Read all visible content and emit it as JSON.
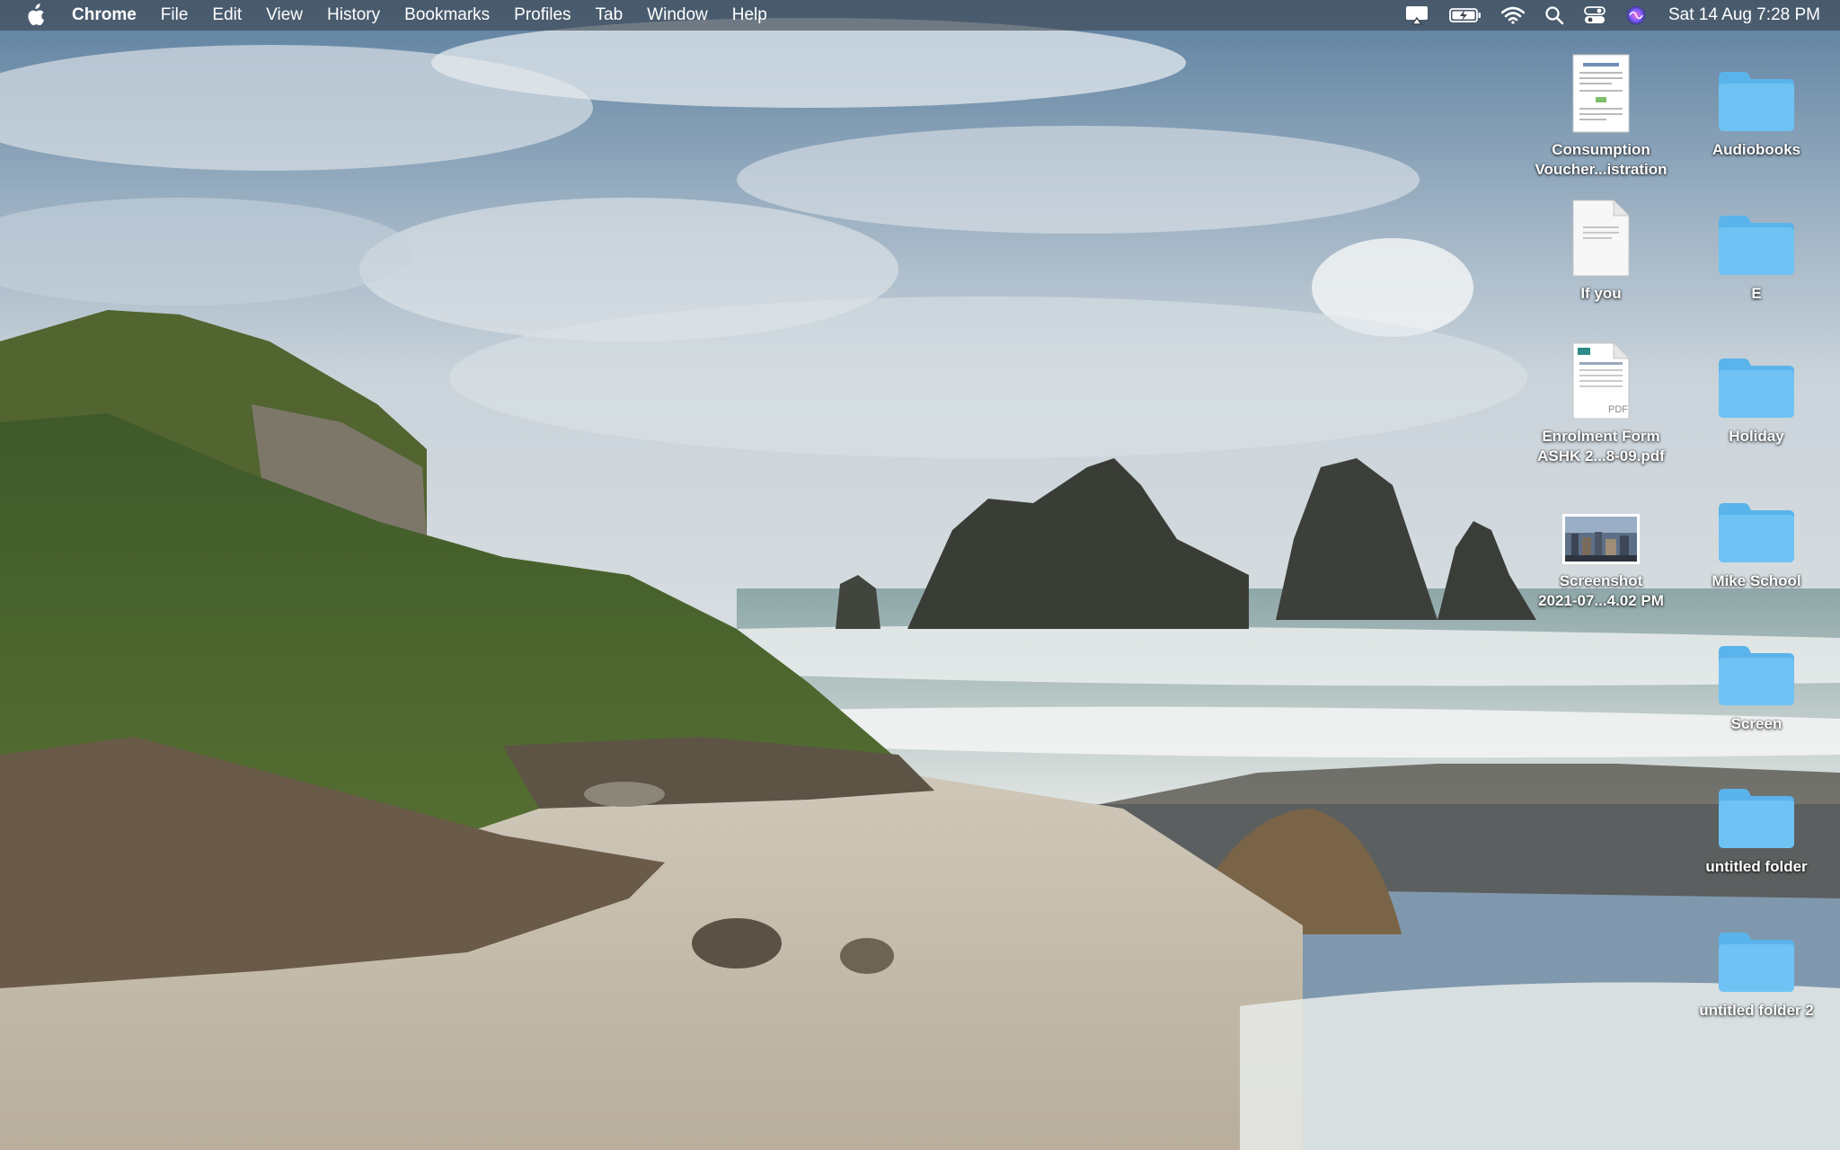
{
  "menubar": {
    "apple_icon": "apple-logo-icon",
    "app_name": "Chrome",
    "menus": [
      "File",
      "Edit",
      "View",
      "History",
      "Bookmarks",
      "Profiles",
      "Tab",
      "Window",
      "Help"
    ],
    "status_icons": [
      "screen-mirroring-icon",
      "battery-charging-icon",
      "wifi-icon",
      "spotlight-search-icon",
      "control-center-icon",
      "siri-icon"
    ],
    "clock": "Sat 14 Aug  7:28 PM"
  },
  "desktop": {
    "files": [
      {
        "name": "Consumption Voucher...istration",
        "line1": "Consumption",
        "line2": "Voucher...istration",
        "icon": "document-thumbnail-icon"
      },
      {
        "name": "If you",
        "line1": "If you",
        "line2": "",
        "icon": "text-document-icon"
      },
      {
        "name": "Enrolment Form ASHK 2...8-09.pdf",
        "line1": "Enrolment Form",
        "line2": "ASHK 2...8-09.pdf",
        "icon": "pdf-document-icon"
      },
      {
        "name": "Screenshot 2021-07...4.02 PM",
        "line1": "Screenshot",
        "line2": "2021-07...4.02 PM",
        "icon": "screenshot-thumbnail-icon"
      }
    ],
    "folders": [
      {
        "name": "Audiobooks",
        "icon": "folder-icon"
      },
      {
        "name": "E",
        "icon": "folder-icon"
      },
      {
        "name": "Holiday",
        "icon": "folder-icon"
      },
      {
        "name": "Mike School",
        "icon": "folder-icon"
      },
      {
        "name": "Screen",
        "icon": "folder-icon"
      },
      {
        "name": "untitled folder",
        "icon": "folder-icon"
      },
      {
        "name": "untitled folder 2",
        "icon": "folder-icon"
      }
    ],
    "colors": {
      "folder": "#6ec3f4",
      "folder_tab": "#5ab3ea",
      "menubar": "#3c444e"
    }
  }
}
